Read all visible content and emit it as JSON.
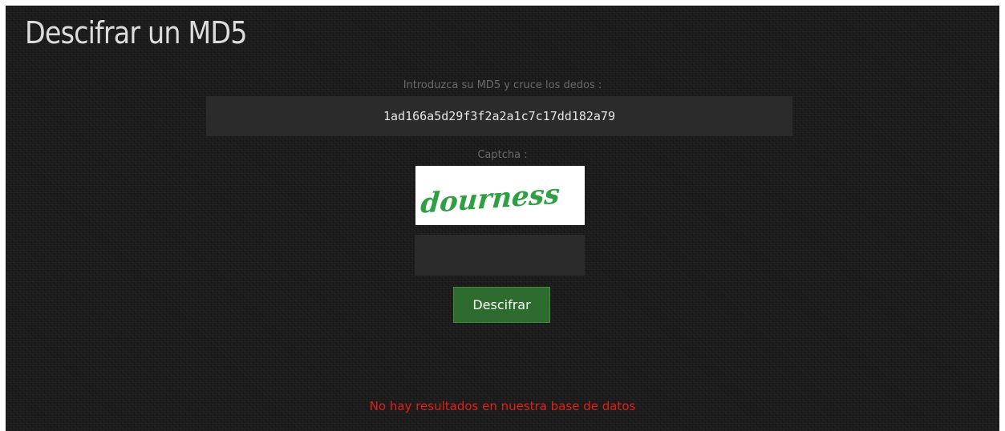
{
  "page": {
    "title": "Descifrar un MD5"
  },
  "form": {
    "md5_label": "Introduzca su MD5 y cruce los dedos :",
    "md5_value": "1ad166a5d29f3f2a2a1c7c17dd182a79",
    "captcha_label": "Captcha :",
    "captcha_text": "dourness",
    "captcha_value": "",
    "submit_label": "Descifrar"
  },
  "result": {
    "message": "No hay resultados en nuestra base de datos"
  },
  "colors": {
    "background": "#1b1b1b",
    "input_background": "#2b2b2b",
    "button": "#2e6b2e",
    "error": "#e0201a",
    "captcha_text": "#2ea043"
  }
}
